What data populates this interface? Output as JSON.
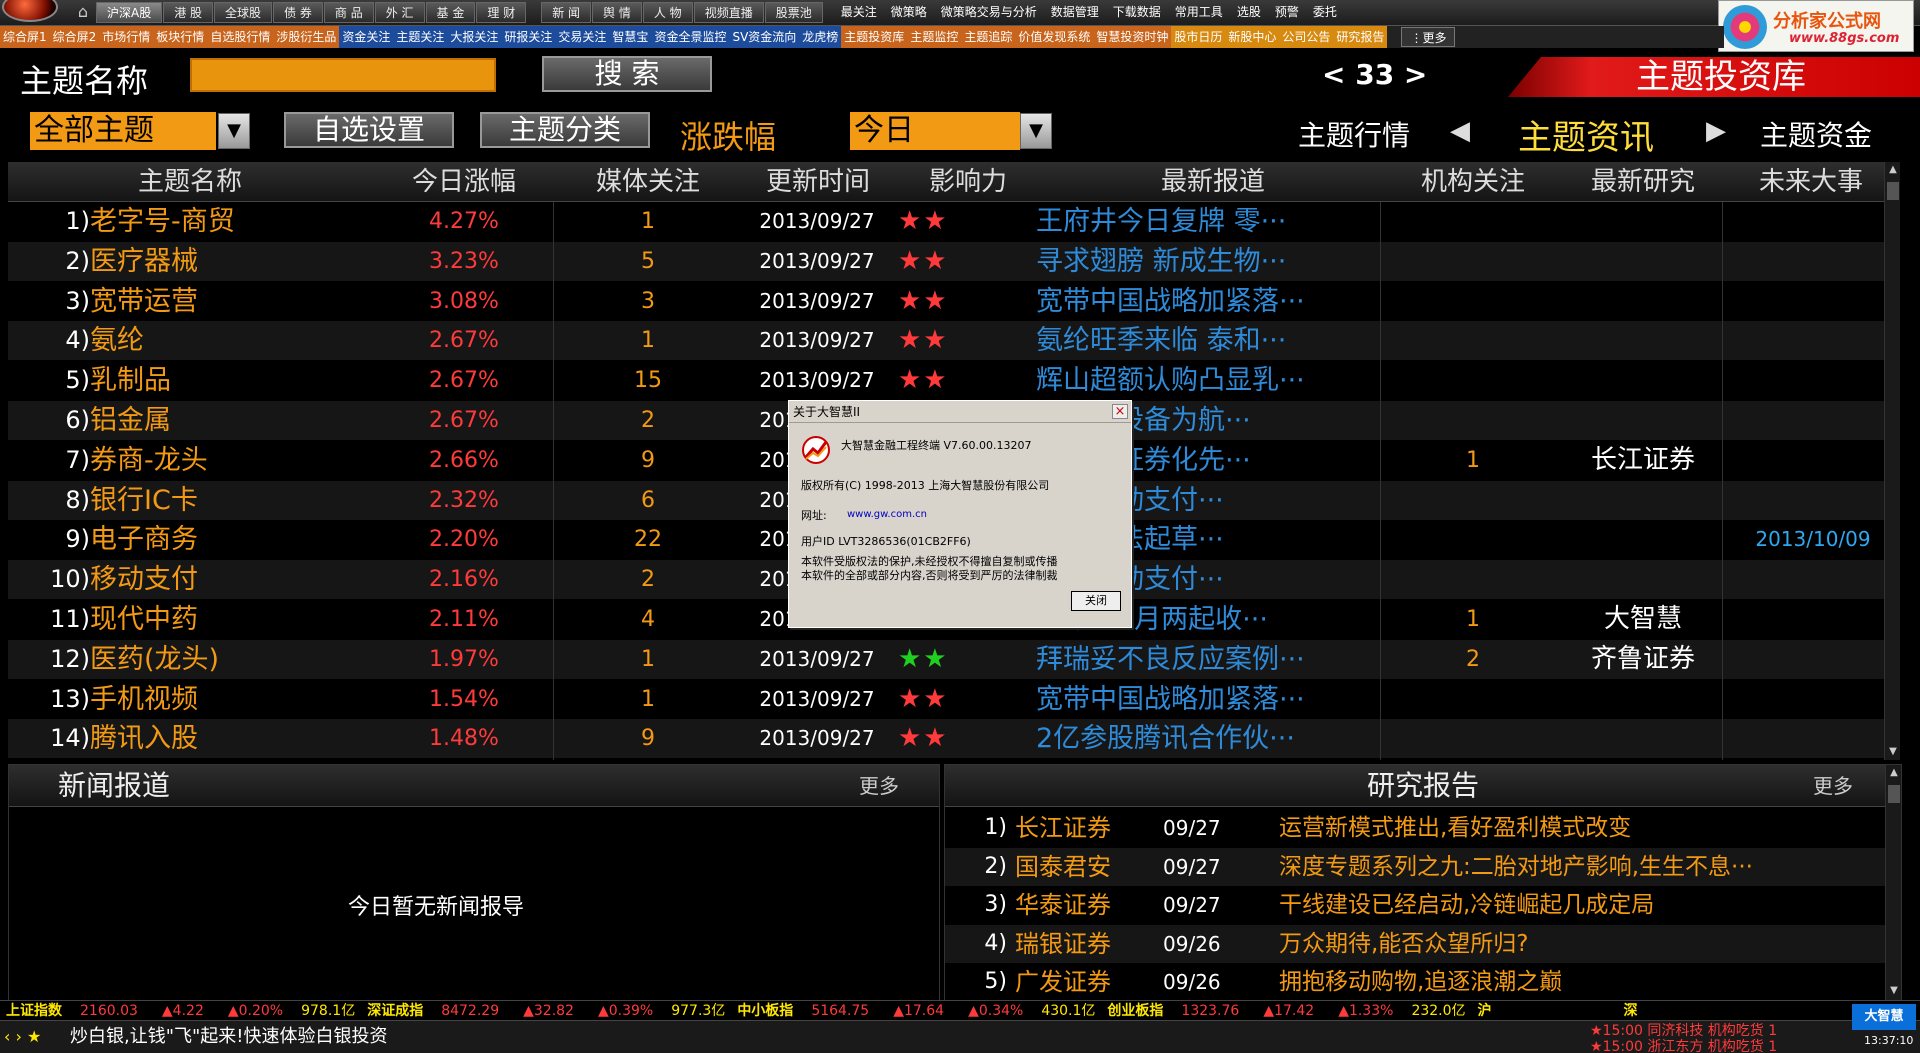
{
  "topbar": {
    "menus_boxed": [
      "沪深A股",
      "港 股",
      "全球股",
      "债 券",
      "商 品",
      "外 汇",
      "基 金",
      "理 财"
    ],
    "menus_boxed2": [
      "新 闻",
      "舆 情",
      "人 物",
      "视频直播",
      "股票池"
    ],
    "menus_plain": [
      "最关注",
      "微策略",
      "微策略交易与分析",
      "数据管理",
      "下载数据",
      "常用工具",
      "选股",
      "预警",
      "委托"
    ],
    "brand_title": "分析家公式网",
    "brand_url": "www.88gs.com"
  },
  "navbar2": {
    "items": [
      {
        "label": "综合屏1",
        "tone": "orange"
      },
      {
        "label": "综合屏2",
        "tone": "orange"
      },
      {
        "label": "市场行情",
        "tone": "orange"
      },
      {
        "label": "板块行情",
        "tone": "orange"
      },
      {
        "label": "自选股行情",
        "tone": "orange"
      },
      {
        "label": "涉股衍生品",
        "tone": "orange"
      },
      {
        "label": "资金关注",
        "tone": "blue"
      },
      {
        "label": "主题关注",
        "tone": "blue"
      },
      {
        "label": "大报关注",
        "tone": "blue"
      },
      {
        "label": "研报关注",
        "tone": "blue"
      },
      {
        "label": "交易关注",
        "tone": "blue"
      },
      {
        "label": "智慧宝",
        "tone": "blue"
      },
      {
        "label": "资金全景监控",
        "tone": "blue"
      },
      {
        "label": "SV资金流向",
        "tone": "blue"
      },
      {
        "label": "龙虎榜",
        "tone": "blue"
      },
      {
        "label": "主题投资库",
        "tone": "orange"
      },
      {
        "label": "主题监控",
        "tone": "orange"
      },
      {
        "label": "主题追踪",
        "tone": "orange"
      },
      {
        "label": "价值发现系统",
        "tone": "orange"
      },
      {
        "label": "智慧投资时钟",
        "tone": "orange"
      },
      {
        "label": "股市日历",
        "tone": "yellow"
      },
      {
        "label": "新股中心",
        "tone": "yellow"
      },
      {
        "label": "公司公告",
        "tone": "yellow"
      },
      {
        "label": "研究报告",
        "tone": "yellow"
      }
    ],
    "more": "⋮更多"
  },
  "search": {
    "label": "主题名称",
    "value": "",
    "button": "搜  索",
    "pager": "< 33 >",
    "banner": "主题投资库"
  },
  "filter": {
    "category": "全部主题",
    "custom_button": "自选设置",
    "classify_button": "主题分类",
    "sort_label": "涨跌幅",
    "period": "今日",
    "nav_left": "主题行情",
    "nav_active": "主题资讯",
    "nav_right": "主题资金"
  },
  "table": {
    "headers": [
      "主题名称",
      "今日涨幅",
      "媒体关注",
      "更新时间",
      "影响力",
      "最新报道",
      "机构关注",
      "最新研究",
      "未来大事"
    ],
    "rows": [
      {
        "idx": "1)",
        "name": "老字号-商贸",
        "pct": "4.27%",
        "media": "1",
        "date": "2013/09/27",
        "stars": "★★",
        "star_color": "red",
        "news": "王府井今日复牌  零···",
        "inst": "",
        "research": "",
        "future": ""
      },
      {
        "idx": "2)",
        "name": "医疗器械",
        "pct": "3.23%",
        "media": "5",
        "date": "2013/09/27",
        "stars": "★★",
        "star_color": "red",
        "news": "寻求翅膀  新成生物···",
        "inst": "",
        "research": "",
        "future": ""
      },
      {
        "idx": "3)",
        "name": "宽带运营",
        "pct": "3.08%",
        "media": "3",
        "date": "2013/09/27",
        "stars": "★★",
        "star_color": "red",
        "news": "宽带中国战略加紧落···",
        "inst": "",
        "research": "",
        "future": ""
      },
      {
        "idx": "4)",
        "name": "氨纶",
        "pct": "2.67%",
        "media": "1",
        "date": "2013/09/27",
        "stars": "★★",
        "star_color": "red",
        "news": "氨纶旺季来临  泰和···",
        "inst": "",
        "research": "",
        "future": ""
      },
      {
        "idx": "5)",
        "name": "乳制品",
        "pct": "2.67%",
        "media": "15",
        "date": "2013/09/27",
        "stars": "★★",
        "star_color": "red",
        "news": "辉山超额认购凸显乳···",
        "inst": "",
        "research": "",
        "future": ""
      },
      {
        "idx": "6)",
        "name": "铝金属",
        "pct": "2.67%",
        "media": "2",
        "date": "2013/09/27",
        "stars": "★★",
        "star_color": "red",
        "news": "忠旺以设备为航···",
        "inst": "",
        "research": "",
        "future": ""
      },
      {
        "idx": "7)",
        "name": "券商-龙头",
        "pct": "2.66%",
        "media": "9",
        "date": "2013/09/27",
        "stars": "★★",
        "star_color": "red",
        "news": "移动产证券化先···",
        "inst": "1",
        "research": "长江证券",
        "future": ""
      },
      {
        "idx": "8)",
        "name": "银行IC卡",
        "pct": "2.32%",
        "media": "6",
        "date": "2013/09/27",
        "stars": "★★",
        "star_color": "red",
        "news": "卡及移动支付···",
        "inst": "",
        "research": "",
        "future": ""
      },
      {
        "idx": "9)",
        "name": "电子商务",
        "pct": "2.20%",
        "media": "22",
        "date": "2013/09/27",
        "stars": "★★",
        "star_color": "red",
        "news": "务促进法起草···",
        "inst": "",
        "research": "",
        "future": "2013/10/09"
      },
      {
        "idx": "10)",
        "name": "移动支付",
        "pct": "2.16%",
        "media": "2",
        "date": "2013/09/27",
        "stars": "★★",
        "star_color": "red",
        "news": "卡及移动支付···",
        "inst": "",
        "research": "",
        "future": ""
      },
      {
        "idx": "11)",
        "name": "现代中药",
        "pct": "2.11%",
        "media": "4",
        "date": "2013/09/27",
        "stars": "★★",
        "star_color": "red",
        "news": "一年1个月两起收···",
        "inst": "1",
        "research": "大智慧",
        "future": ""
      },
      {
        "idx": "12)",
        "name": "医药(龙头)",
        "pct": "1.97%",
        "media": "1",
        "date": "2013/09/27",
        "stars": "★★",
        "star_color": "green",
        "news": "拜瑞妥不良反应案例···",
        "inst": "2",
        "research": "齐鲁证券",
        "future": ""
      },
      {
        "idx": "13)",
        "name": "手机视频",
        "pct": "1.54%",
        "media": "1",
        "date": "2013/09/27",
        "stars": "★★",
        "star_color": "red",
        "news": "宽带中国战略加紧落···",
        "inst": "",
        "research": "",
        "future": ""
      },
      {
        "idx": "14)",
        "name": "腾讯入股",
        "pct": "1.48%",
        "media": "9",
        "date": "2013/09/27",
        "stars": "★★",
        "star_color": "red",
        "news": "2亿参股腾讯合作伙···",
        "inst": "",
        "research": "",
        "future": ""
      }
    ]
  },
  "news_panel": {
    "title": "新闻报道",
    "more": "更多",
    "empty": "今日暂无新闻报导"
  },
  "research_panel": {
    "title": "研究报告",
    "more": "更多",
    "rows": [
      {
        "idx": "1)",
        "org": "长江证券",
        "date": "09/27",
        "title": "运营新模式推出,看好盈利模式改变"
      },
      {
        "idx": "2)",
        "org": "国泰君安",
        "date": "09/27",
        "title": "深度专题系列之九:二胎对地产影响,生生不息···"
      },
      {
        "idx": "3)",
        "org": "华泰证券",
        "date": "09/27",
        "title": "干线建设已经启动,冷链崛起几成定局"
      },
      {
        "idx": "4)",
        "org": "瑞银证券",
        "date": "09/26",
        "title": "万众期待,能否众望所归?"
      },
      {
        "idx": "5)",
        "org": "广发证券",
        "date": "09/26",
        "title": "拥抱移动购物,追逐浪潮之巅"
      }
    ]
  },
  "ticker": [
    {
      "name": "上证指数",
      "value": "2160.03",
      "chg": "▲4.22",
      "pct": "▲0.20%",
      "vol": "978.1亿"
    },
    {
      "name": "深证成指",
      "value": "8472.29",
      "chg": "▲32.82",
      "pct": "▲0.39%",
      "vol": "977.3亿"
    },
    {
      "name": "中小板指",
      "value": "5164.75",
      "chg": "▲17.64",
      "pct": "▲0.34%",
      "vol": "430.1亿"
    },
    {
      "name": "创业板指",
      "value": "1323.76",
      "chg": "▲17.42",
      "pct": "▲1.33%",
      "vol": "232.0亿"
    }
  ],
  "ticker_tail": {
    "left": "沪",
    "right": "深"
  },
  "status": {
    "arrows": "‹ › ★",
    "message": "炒白银,让钱\"飞\"起来!快速体验白银投资",
    "alerts": [
      "★15:00 同济科技  机构吃货  1",
      "★15:00 浙江东方  机构吃货  1"
    ],
    "logo": "大智慧",
    "time": "13:37:10"
  },
  "dialog": {
    "title": "关于大智慧II",
    "product": "大智慧金融工程终端   V7.60.00.13207",
    "copyright": "版权所有(C) 1998-2013  上海大智慧股份有限公司",
    "url_label": "网址:",
    "url": "www.gw.com.cn",
    "user_id": "用户ID LVT3286536(01CB2FF6)",
    "notice1": "本软件受版权法的保护,未经授权不得擅自复制或传播",
    "notice2": "本软件的全部或部分内容,否则将受到严厉的法律制裁",
    "ok": "关闭",
    "close_glyph": "×"
  }
}
